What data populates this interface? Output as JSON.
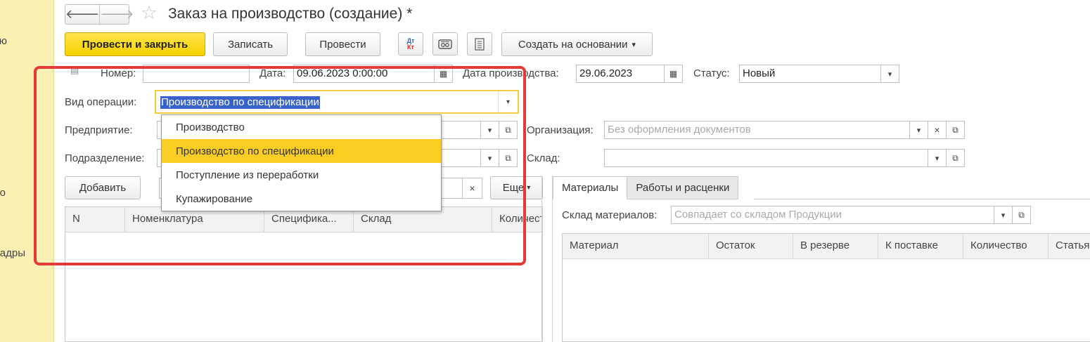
{
  "left_panel": {
    "items": [
      "ю",
      "о",
      "адры"
    ]
  },
  "header": {
    "title": "Заказ на производство (создание) *"
  },
  "toolbar": {
    "post_close_label": "Провести и закрыть",
    "save_label": "Записать",
    "post_label": "Провести",
    "dtkt_top": "Дт",
    "dtkt_bottom": "Кт",
    "create_based_label": "Создать на основании",
    "dropdown_arrow": "▾"
  },
  "form": {
    "number_label": "Номер:",
    "number_value": "",
    "date_label": "Дата:",
    "date_value": "09.06.2023  0:00:00",
    "prod_date_label": "Дата производства:",
    "prod_date_value": "29.06.2023",
    "status_label": "Статус:",
    "status_value": "Новый",
    "operation_label": "Вид операции:",
    "operation_value": "Производство по спецификации",
    "enterprise_label": "Предприятие:",
    "organization_label": "Организация:",
    "organization_placeholder": "Без оформления документов",
    "department_label": "Подразделение:",
    "warehouse_label": "Склад:"
  },
  "operation_dropdown": {
    "options": [
      "Производство",
      "Производство по спецификации",
      "Поступление из переработки",
      "Купажирование"
    ],
    "selected_index": 1
  },
  "left_table": {
    "add_label": "Добавить",
    "more_label": "Еще",
    "columns": [
      "N",
      "Номенклатура",
      "Специфика...",
      "Склад",
      "Количество"
    ]
  },
  "tabs": [
    "Материалы",
    "Работы и расценки"
  ],
  "materials": {
    "warehouse_label": "Склад материалов:",
    "warehouse_placeholder": "Совпадает со складом Продукции",
    "columns": [
      "Материал",
      "Остаток",
      "В резерве",
      "К поставке",
      "Количество",
      "Статья"
    ]
  },
  "colors": {
    "accent_yellow": "#f5d100",
    "highlight_red": "#e53935",
    "selection_blue": "#3963c8"
  }
}
